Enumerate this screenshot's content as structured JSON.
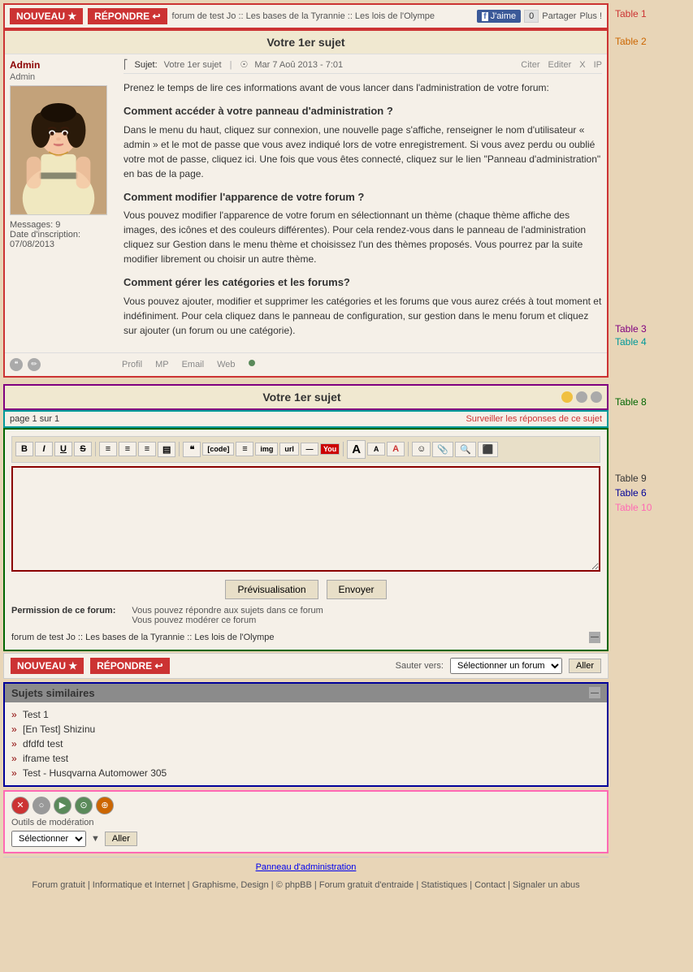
{
  "toolbar": {
    "nouveau_label": "NOUVEAU ★",
    "repondre_label": "RÉPONDRE ↩",
    "breadcrumb": "forum de test Jo :: Les bases de la Tyrannie :: Les lois de l'Olympe",
    "fb_like": "J'aime",
    "share": "Partager",
    "plus": "Plus !"
  },
  "post": {
    "title": "Votre 1er sujet",
    "author": "Admin",
    "author_role": "Admin",
    "subject_label": "Sujet:",
    "subject": "Votre 1er sujet",
    "date": "Mar 7 Aoû 2013 - 7:01",
    "citer": "Citer",
    "editer": "Editer",
    "x": "X",
    "ip": "IP",
    "content_intro": "Prenez le temps de lire ces informations avant de vous lancer dans l'administration de votre forum:",
    "h1": "Comment accéder à votre panneau d'administration ?",
    "p1": "Dans le menu du haut, cliquez sur connexion, une nouvelle page s'affiche, renseigner le nom d'utilisateur « admin » et le mot de passe que vous avez indiqué lors de votre enregistrement. Si vous avez perdu ou oublié votre mot de passe, cliquez ici. Une fois que vous êtes connecté, cliquez sur le lien \"Panneau d'administration\" en bas de la page.",
    "h2": "Comment modifier l'apparence de votre forum ?",
    "p2": "Vous pouvez modifier l'apparence de votre forum en sélectionnant un thème (chaque thème affiche des images, des icônes et des couleurs différentes). Pour cela rendez-vous dans le panneau de l'administration cliquez sur Gestion dans le menu thème et choisissez l'un des thèmes proposés. Vous pourrez par la suite modifier librement ou choisir un autre thème.",
    "h3": "Comment gérer les catégories et les forums?",
    "p3": "Vous pouvez ajouter, modifier et supprimer les catégories et les forums que vous aurez créés à tout moment et indéfiniment. Pour cela cliquez dans le panneau de configuration, sur gestion dans le menu forum et cliquez sur ajouter (un forum ou une catégorie).",
    "messages_label": "Messages:",
    "messages_count": "9",
    "inscription_label": "Date d'inscription:",
    "inscription_date": "07/08/2013",
    "footer_profil": "Profil",
    "footer_mp": "MP",
    "footer_email": "Email",
    "footer_web": "Web"
  },
  "reply": {
    "title": "Votre 1er sujet",
    "page_info": "page 1 sur 1",
    "surveiller": "Surveiller les réponses de ce sujet"
  },
  "editor": {
    "bold": "B",
    "italic": "I",
    "underline": "U",
    "strikethrough": "S",
    "align_left": "≡",
    "align_center": "≡",
    "align_right": "≡",
    "align_justify": "≡",
    "quote": "❝",
    "code": "{}",
    "list": "☰",
    "img": "🖼",
    "link": "🔗",
    "youtube": "You",
    "font_size": "A",
    "font_color": "A",
    "smiley": "☺",
    "preview_btn": "Prévisualisation",
    "send_btn": "Envoyer",
    "permission_label": "Permission de ce forum:",
    "permission1": "Vous pouvez répondre aux sujets dans ce forum",
    "permission2": "Vous pouvez modérer ce forum",
    "breadcrumb": "forum de test Jo :: Les bases de la Tyrannie :: Les lois de l'Olympe"
  },
  "bottom_toolbar": {
    "nouveau_label": "NOUVEAU ★",
    "repondre_label": "RÉPONDRE ↩",
    "sauter_vers": "Sauter vers:",
    "select_placeholder": "Sélectionner un forum",
    "aller": "Aller"
  },
  "similar_subjects": {
    "title": "Sujets similaires",
    "items": [
      "Test 1",
      "[En Test] Shizinu",
      "dfdfd test",
      "iframe test",
      "Test - Husqvarna Automower 305"
    ]
  },
  "moderation": {
    "label": "Outils de modération",
    "select_placeholder": "Sélectionner",
    "aller": "Aller"
  },
  "footer": {
    "admin_link": "Panneau d'administration",
    "links": [
      "Forum gratuit",
      "Informatique et Internet",
      "Graphisme, Design",
      "© phpBB",
      "Forum gratuit d'entraide",
      "Statistiques",
      "Contact",
      "Signaler un abus"
    ]
  },
  "table_labels": {
    "t1": "Table 1",
    "t2": "Table 2",
    "t3": "Table 3",
    "t4": "Table 4",
    "t8": "Table 8",
    "t9": "Table 9",
    "t6": "Table 6",
    "t10": "Table 10"
  }
}
